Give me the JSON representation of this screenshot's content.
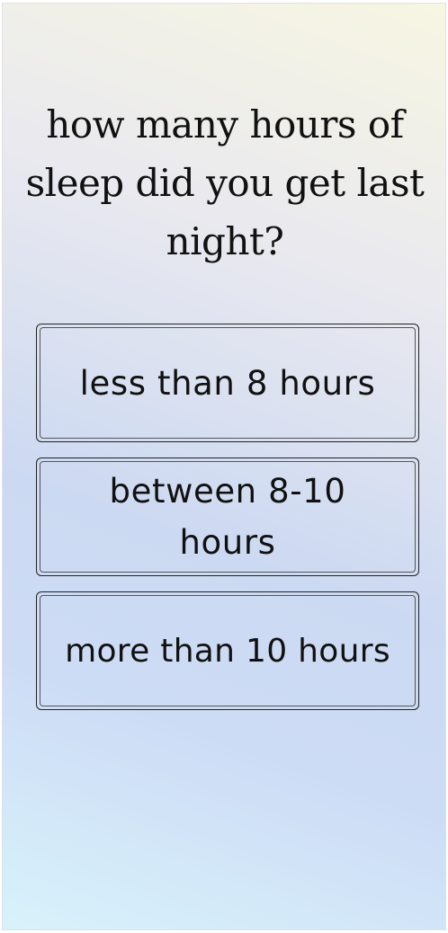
{
  "question": {
    "text": "how many hours of sleep did you get last night?"
  },
  "options": [
    {
      "label": "less than 8 hours"
    },
    {
      "label": "between 8-10 hours"
    },
    {
      "label": "more than 10 hours"
    }
  ],
  "colors": {
    "background_top": "#f7f6e2",
    "background_mid": "#ccd9f2",
    "background_bottom": "#d8f2fb",
    "text": "#111111",
    "border": "#222222"
  }
}
